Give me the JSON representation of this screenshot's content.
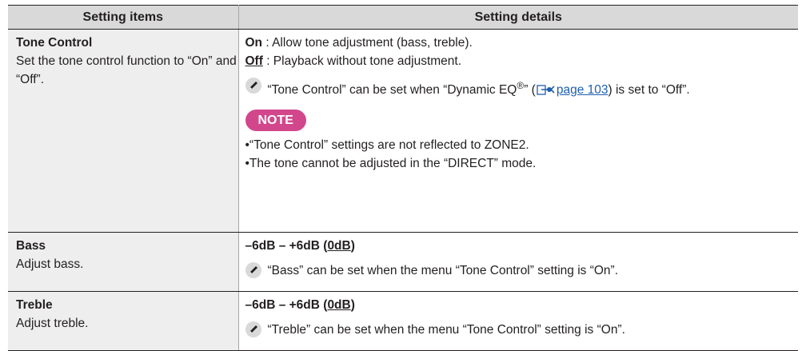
{
  "header": {
    "col1": "Setting items",
    "col2": "Setting details"
  },
  "tone_control": {
    "title": "Tone Control",
    "desc": "Set the tone control function to “On” and “Off”.",
    "on_key": "On",
    "on_text": " : Allow tone adjustment (bass, treble).",
    "off_key": "Off",
    "off_text": " : Playback without tone adjustment.",
    "note_pre": "“Tone Control” can be set when “Dynamic EQ",
    "note_reg": "®",
    "note_mid": "” (",
    "note_link": "page 103",
    "note_post": ") is set to “Off”.",
    "note_badge": "NOTE",
    "bullets": [
      "•“Tone Control” settings are not reflected to ZONE2.",
      "•The tone cannot be adjusted in the “DIRECT” mode."
    ]
  },
  "bass": {
    "title": "Bass",
    "desc": "Adjust bass.",
    "range": "–6dB – +6dB (",
    "range_default": "0dB",
    "range_close": ")",
    "note": "“Bass” can be set when the menu “Tone Control” setting is “On”."
  },
  "treble": {
    "title": "Treble",
    "desc": "Adjust treble.",
    "range": "–6dB – +6dB (",
    "range_default": "0dB",
    "range_close": ")",
    "note": "“Treble” can be set when the menu “Tone Control” setting is “On”."
  },
  "colors": {
    "note_badge": "#d2478c",
    "link": "#1f5fae",
    "header_bg": "#d9d9d9",
    "item_bg": "#eeeeee"
  },
  "icons": {
    "pencil": "pencil-icon",
    "reference": "page-reference-icon"
  }
}
